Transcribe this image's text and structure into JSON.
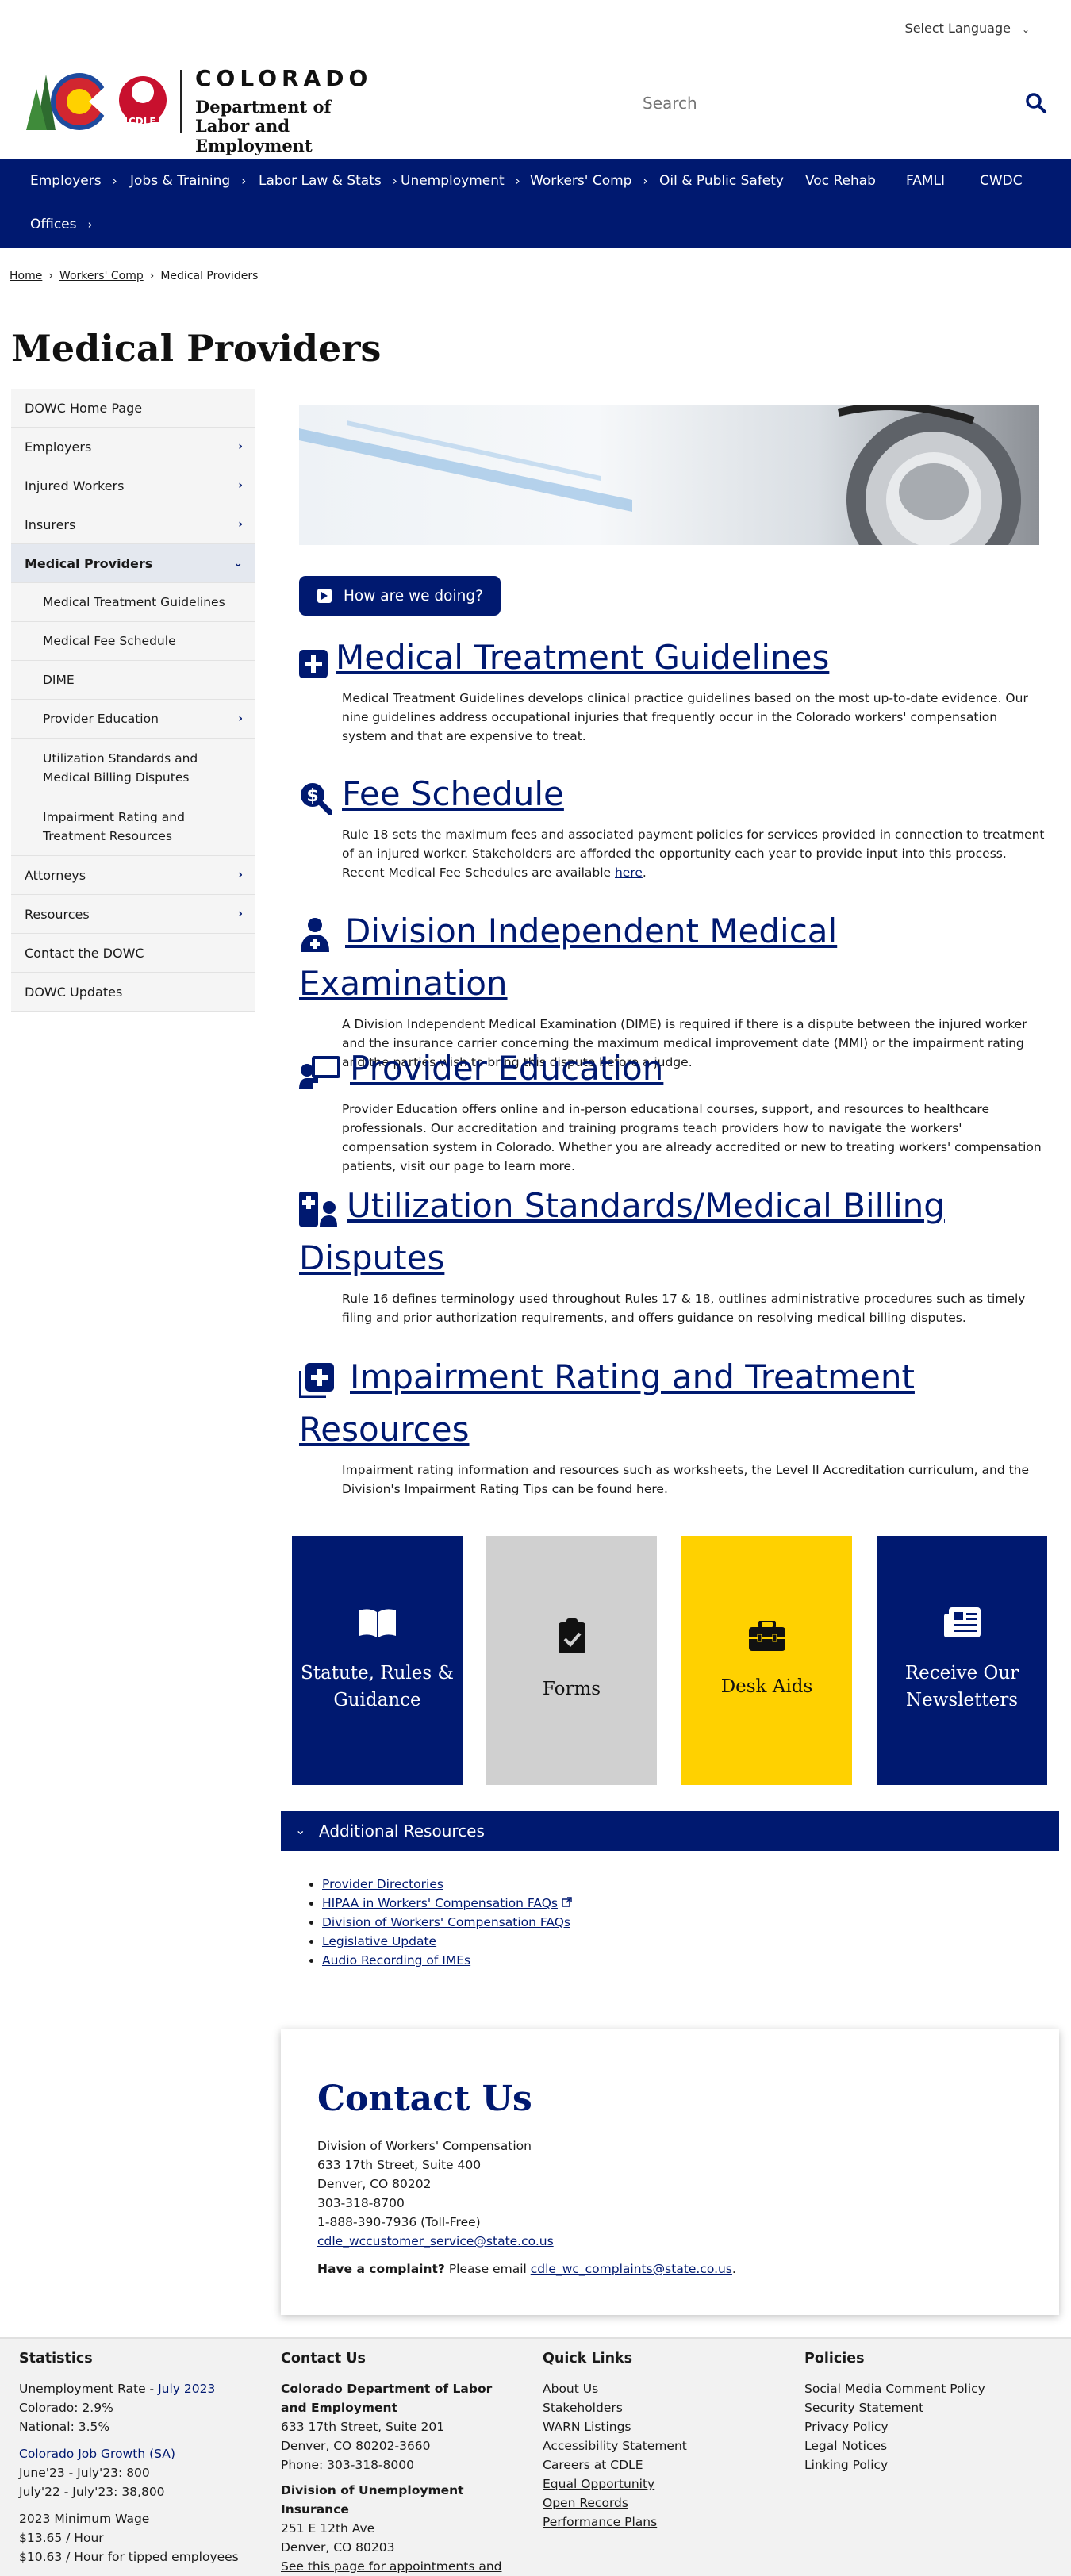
{
  "header": {
    "language_label": "Select Language",
    "logo": {
      "state": "COLORADO",
      "dept_line1": "Department of",
      "dept_line2": "Labor and Employment",
      "seal": "CDLE"
    },
    "search_placeholder": "Search"
  },
  "nav": {
    "items": [
      {
        "label": "Employers",
        "chevron": true
      },
      {
        "label": "Jobs & Training",
        "chevron": true
      },
      {
        "label": "Labor Law & Stats",
        "chevron": true
      },
      {
        "label": "Unemployment",
        "chevron": true
      },
      {
        "label": "Workers' Comp",
        "chevron": true
      },
      {
        "label": "Oil & Public Safety",
        "chevron": false
      },
      {
        "label": "Voc Rehab",
        "chevron": false
      },
      {
        "label": "FAMLI",
        "chevron": false
      },
      {
        "label": "CWDC",
        "chevron": false
      },
      {
        "label": "Offices",
        "chevron": true
      }
    ]
  },
  "breadcrumb": {
    "home": "Home",
    "section": "Workers' Comp",
    "current": "Medical Providers",
    "sep": "›"
  },
  "page_title": "Medical Providers",
  "sidebar": {
    "items": [
      {
        "label": "DOWC Home Page",
        "arrow": ""
      },
      {
        "label": "Employers",
        "arrow": "›"
      },
      {
        "label": "Injured Workers",
        "arrow": "›"
      },
      {
        "label": "Insurers",
        "arrow": "›"
      },
      {
        "label": "Medical Providers",
        "arrow": "⌄"
      },
      {
        "label": "Medical Treatment Guidelines",
        "arrow": ""
      },
      {
        "label": "Medical Fee Schedule",
        "arrow": ""
      },
      {
        "label": "DIME",
        "arrow": ""
      },
      {
        "label": "Provider Education",
        "arrow": "›"
      },
      {
        "label": "Utilization Standards and Medical Billing Disputes",
        "arrow": ""
      },
      {
        "label": "Impairment Rating and Treatment Resources",
        "arrow": ""
      },
      {
        "label": "Attorneys",
        "arrow": "›"
      },
      {
        "label": "Resources",
        "arrow": "›"
      },
      {
        "label": "Contact the DOWC",
        "arrow": ""
      },
      {
        "label": "DOWC Updates",
        "arrow": ""
      }
    ]
  },
  "feedback_button": "How are we doing?",
  "sections": [
    {
      "title": "Medical Treatment Guidelines",
      "icon": "medical-kit-icon",
      "body": "Medical Treatment Guidelines develops clinical practice guidelines based on the most up-to-date evidence. Our nine guidelines address occupational injuries that frequently occur in the Colorado workers' compensation system and that are expensive to treat."
    },
    {
      "title": "Fee Schedule",
      "icon": "search-dollar-icon",
      "body_before": "Rule 18 sets the maximum fees and associated payment policies for services provided in connection to treatment of an injured worker. Stakeholders are afforded the opportunity each year to provide input into this process. Recent Medical Fee Schedules are available ",
      "body_link": "here",
      "body_after": "."
    },
    {
      "title": "Division Independent Medical Examination",
      "icon": "doctor-icon",
      "body": "A Division Independent Medical Examination (DIME) is required if there is a dispute between the injured worker and the insurance carrier concerning the maximum medical improvement date (MMI) or the impairment rating and the parties wish to bring this dispute before a judge."
    },
    {
      "title": "Provider Education",
      "icon": "teacher-icon",
      "body": "Provider Education offers online and in-person educational courses, support, and resources to healthcare professionals. Our accreditation and training programs teach providers how to navigate the workers' compensation system in Colorado. Whether you are already accredited or new to treating workers' compensation patients, visit our page to learn more."
    },
    {
      "title": "Utilization Standards/Medical Billing Disputes",
      "icon": "medical-billing-icon",
      "body": "Rule 16 defines terminology used throughout Rules 17 & 18, outlines administrative procedures such as timely filing and prior authorization requirements, and offers guidance on resolving medical billing disputes."
    },
    {
      "title": "Impairment Rating and Treatment Resources",
      "icon": "medical-plus-icon",
      "body": "Impairment rating information and resources such as worksheets, the Level II Accreditation curriculum, and the Division's Impairment Rating Tips can be found here."
    }
  ],
  "tiles": [
    {
      "label": "Statute, Rules & Guidance",
      "icon": "book-icon",
      "bg": "#001970",
      "fg": "#ffffff"
    },
    {
      "label": "Forms",
      "icon": "clipboard-check-icon",
      "bg": "#d0d0d0",
      "fg": "#111111"
    },
    {
      "label": "Desk Aids",
      "icon": "toolbox-icon",
      "bg": "#ffd100",
      "fg": "#111111"
    },
    {
      "label": "Receive Our Newsletters",
      "icon": "newspaper-icon",
      "bg": "#001970",
      "fg": "#ffffff"
    }
  ],
  "additional_resources": {
    "title": "Additional Resources",
    "links": [
      "Provider Directories",
      "HIPAA in Workers' Compensation FAQs",
      "Division of Workers' Compensation FAQs",
      "Legislative Update",
      "Audio Recording of IMEs"
    ]
  },
  "contact": {
    "title": "Contact Us",
    "lines": [
      "Division of Workers' Compensation",
      "633 17th Street, Suite 400",
      "Denver, CO 80202",
      "303-318-8700",
      "1-888-390-7936 (Toll-Free)"
    ],
    "email": "cdle_wccustomer_service@state.co.us",
    "complaint_bold": "Have a complaint?",
    "complaint_text": " Please email ",
    "complaint_email": "cdle_wc_complaints@state.co.us",
    "complaint_end": "."
  },
  "footer": {
    "statistics": {
      "title": "Statistics",
      "unemp_prefix": "Unemployment Rate - ",
      "unemp_link": "July 2023",
      "colorado": "Colorado: 2.9%",
      "national": "National: 3.5%",
      "job_link": "Colorado Job Growth (SA)",
      "job1": "June'23 - July'23: 800",
      "job2": "July'22 - July'23: 38,800",
      "wage_title": "2023 Minimum Wage",
      "wage1": "$13.65 / Hour",
      "wage2": "$10.63 / Hour for tipped employees"
    },
    "contact": {
      "title": "Contact Us",
      "org1": "Colorado Department of Labor and Employment",
      "addr1": "633 17th Street, Suite 201",
      "city1": "Denver, CO  80202-3660",
      "phone1": "Phone: 303-318-8000",
      "org2": "Division of Unemployment Insurance",
      "addr2": "251 E 12th Ave",
      "city2": "Denver, CO  80203",
      "link": "See this page for appointments and inquiries"
    },
    "quick_links": {
      "title": "Quick Links",
      "links": [
        "About Us",
        "Stakeholders",
        "WARN Listings",
        "Accessibility Statement",
        "Careers at CDLE",
        "Equal Opportunity",
        "Open Records",
        "Performance Plans"
      ]
    },
    "policies": {
      "title": "Policies",
      "links": [
        "Social Media Comment Policy",
        "Security Statement",
        "Privacy Policy",
        "Legal Notices",
        "Linking Policy"
      ]
    }
  },
  "colors": {
    "navy": "#001970",
    "gold": "#ffd100",
    "grey_tile": "#d0d0d0"
  }
}
